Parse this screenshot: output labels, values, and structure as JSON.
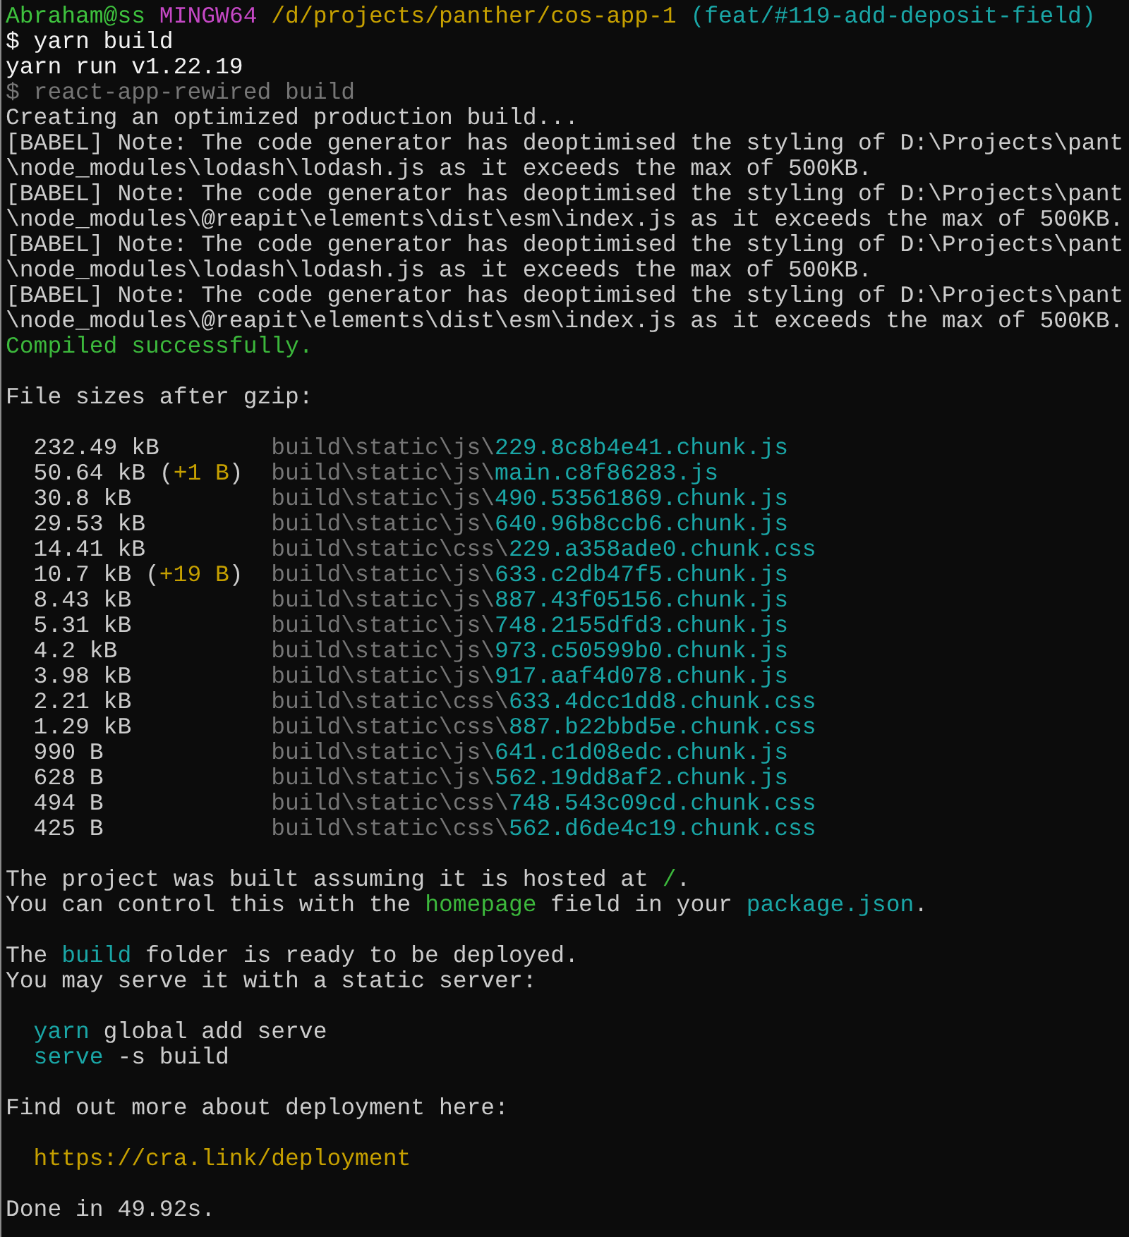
{
  "sections": [
    {
      "kind": "text",
      "lines": [
        [
          {
            "text": "Abraham@ss",
            "color": "#3ec23e"
          },
          {
            "text": " MINGW64",
            "color": "#c548c5"
          },
          {
            "text": " /d/projects/panther/cos-app-1",
            "color": "#c6a000"
          },
          {
            "text": " (feat/#119-add-deposit-field)",
            "color": "#1aa6a6"
          }
        ],
        [
          {
            "text": "$ yarn build",
            "color": "#f2f2f2"
          }
        ],
        [
          {
            "text": "yarn run v1.22.19",
            "color": "#f2f2f2"
          }
        ],
        [
          {
            "text": "$ react-app-rewired build",
            "color": "#767676"
          }
        ],
        [
          {
            "text": "Creating an optimized production build...",
            "color": "#cccccc"
          }
        ],
        [
          {
            "text": "[BABEL] Note: The code generator has deoptimised the styling of D:\\Projects\\pant",
            "color": "#cccccc"
          }
        ],
        [
          {
            "text": "\\node_modules\\lodash\\lodash.js as it exceeds the max of 500KB.",
            "color": "#cccccc"
          }
        ],
        [
          {
            "text": "[BABEL] Note: The code generator has deoptimised the styling of D:\\Projects\\pant",
            "color": "#cccccc"
          }
        ],
        [
          {
            "text": "\\node_modules\\@reapit\\elements\\dist\\esm\\index.js as it exceeds the max of 500KB.",
            "color": "#cccccc"
          }
        ],
        [
          {
            "text": "[BABEL] Note: The code generator has deoptimised the styling of D:\\Projects\\pant",
            "color": "#cccccc"
          }
        ],
        [
          {
            "text": "\\node_modules\\lodash\\lodash.js as it exceeds the max of 500KB.",
            "color": "#cccccc"
          }
        ],
        [
          {
            "text": "[BABEL] Note: The code generator has deoptimised the styling of D:\\Projects\\pant",
            "color": "#cccccc"
          }
        ],
        [
          {
            "text": "\\node_modules\\@reapit\\elements\\dist\\esm\\index.js as it exceeds the max of 500KB.",
            "color": "#cccccc"
          }
        ],
        [
          {
            "text": "Compiled successfully.",
            "color": "#3cb83c"
          }
        ]
      ]
    },
    {
      "kind": "text",
      "lines": [
        [
          {
            "text": "File sizes after gzip:",
            "color": "#cccccc"
          }
        ]
      ]
    },
    {
      "kind": "files",
      "files": [
        {
          "size": "232.49 kB",
          "dir": "build\\static\\js\\",
          "name": "229.8c8b4e41.chunk.js"
        },
        {
          "size": "50.64 kB",
          "change": [
            {
              "text": "(",
              "color": "#cccccc"
            },
            {
              "text": "+1 B",
              "color": "#c6a000"
            },
            {
              "text": ")",
              "color": "#cccccc"
            }
          ],
          "dir": "build\\static\\js\\",
          "name": "main.c8f86283.js"
        },
        {
          "size": "30.8 kB",
          "dir": "build\\static\\js\\",
          "name": "490.53561869.chunk.js"
        },
        {
          "size": "29.53 kB",
          "dir": "build\\static\\js\\",
          "name": "640.96b8ccb6.chunk.js"
        },
        {
          "size": "14.41 kB",
          "dir": "build\\static\\css\\",
          "name": "229.a358ade0.chunk.css"
        },
        {
          "size": "10.7 kB",
          "change": [
            {
              "text": "(",
              "color": "#cccccc"
            },
            {
              "text": "+19 B",
              "color": "#c6a000"
            },
            {
              "text": ")",
              "color": "#cccccc"
            }
          ],
          "dir": "build\\static\\js\\",
          "name": "633.c2db47f5.chunk.js"
        },
        {
          "size": "8.43 kB",
          "dir": "build\\static\\js\\",
          "name": "887.43f05156.chunk.js"
        },
        {
          "size": "5.31 kB",
          "dir": "build\\static\\js\\",
          "name": "748.2155dfd3.chunk.js"
        },
        {
          "size": "4.2 kB",
          "dir": "build\\static\\js\\",
          "name": "973.c50599b0.chunk.js"
        },
        {
          "size": "3.98 kB",
          "dir": "build\\static\\js\\",
          "name": "917.aaf4d078.chunk.js"
        },
        {
          "size": "2.21 kB",
          "dir": "build\\static\\css\\",
          "name": "633.4dcc1dd8.chunk.css"
        },
        {
          "size": "1.29 kB",
          "dir": "build\\static\\css\\",
          "name": "887.b22bbd5e.chunk.css"
        },
        {
          "size": "990 B",
          "dir": "build\\static\\js\\",
          "name": "641.c1d08edc.chunk.js"
        },
        {
          "size": "628 B",
          "dir": "build\\static\\js\\",
          "name": "562.19dd8af2.chunk.js"
        },
        {
          "size": "494 B",
          "dir": "build\\static\\css\\",
          "name": "748.543c09cd.chunk.css"
        },
        {
          "size": "425 B",
          "dir": "build\\static\\css\\",
          "name": "562.d6de4c19.chunk.css"
        }
      ]
    },
    {
      "kind": "text",
      "lines": [
        [
          {
            "text": "The project was built assuming it is hosted at ",
            "color": "#cccccc"
          },
          {
            "text": "/",
            "color": "#3cb83c"
          },
          {
            "text": ".",
            "color": "#cccccc"
          }
        ],
        [
          {
            "text": "You can control this with the ",
            "color": "#cccccc"
          },
          {
            "text": "homepage",
            "color": "#3cb83c"
          },
          {
            "text": " field in your ",
            "color": "#cccccc"
          },
          {
            "text": "package.json",
            "color": "#1aa6a6"
          },
          {
            "text": ".",
            "color": "#cccccc"
          }
        ]
      ]
    },
    {
      "kind": "text",
      "lines": [
        [
          {
            "text": "The ",
            "color": "#cccccc"
          },
          {
            "text": "build",
            "color": "#1aa6a6"
          },
          {
            "text": " folder is ready to be deployed.",
            "color": "#cccccc"
          }
        ],
        [
          {
            "text": "You may serve it with a static server:",
            "color": "#cccccc"
          }
        ]
      ]
    },
    {
      "kind": "text",
      "indented": true,
      "lines": [
        [
          {
            "text": "yarn",
            "color": "#1aa6a6"
          },
          {
            "text": " global add serve",
            "color": "#cccccc"
          }
        ],
        [
          {
            "text": "serve",
            "color": "#1aa6a6"
          },
          {
            "text": " -s build",
            "color": "#cccccc"
          }
        ]
      ]
    },
    {
      "kind": "text",
      "lines": [
        [
          {
            "text": "Find out more about deployment here:",
            "color": "#cccccc"
          }
        ]
      ]
    },
    {
      "kind": "text",
      "indented": true,
      "lines": [
        [
          {
            "text": "https://cra.link/deployment",
            "color": "#c6a000"
          }
        ]
      ]
    },
    {
      "kind": "text",
      "lines": [
        [
          {
            "text": "Done in 49.92s.",
            "color": "#cccccc"
          }
        ]
      ]
    }
  ]
}
